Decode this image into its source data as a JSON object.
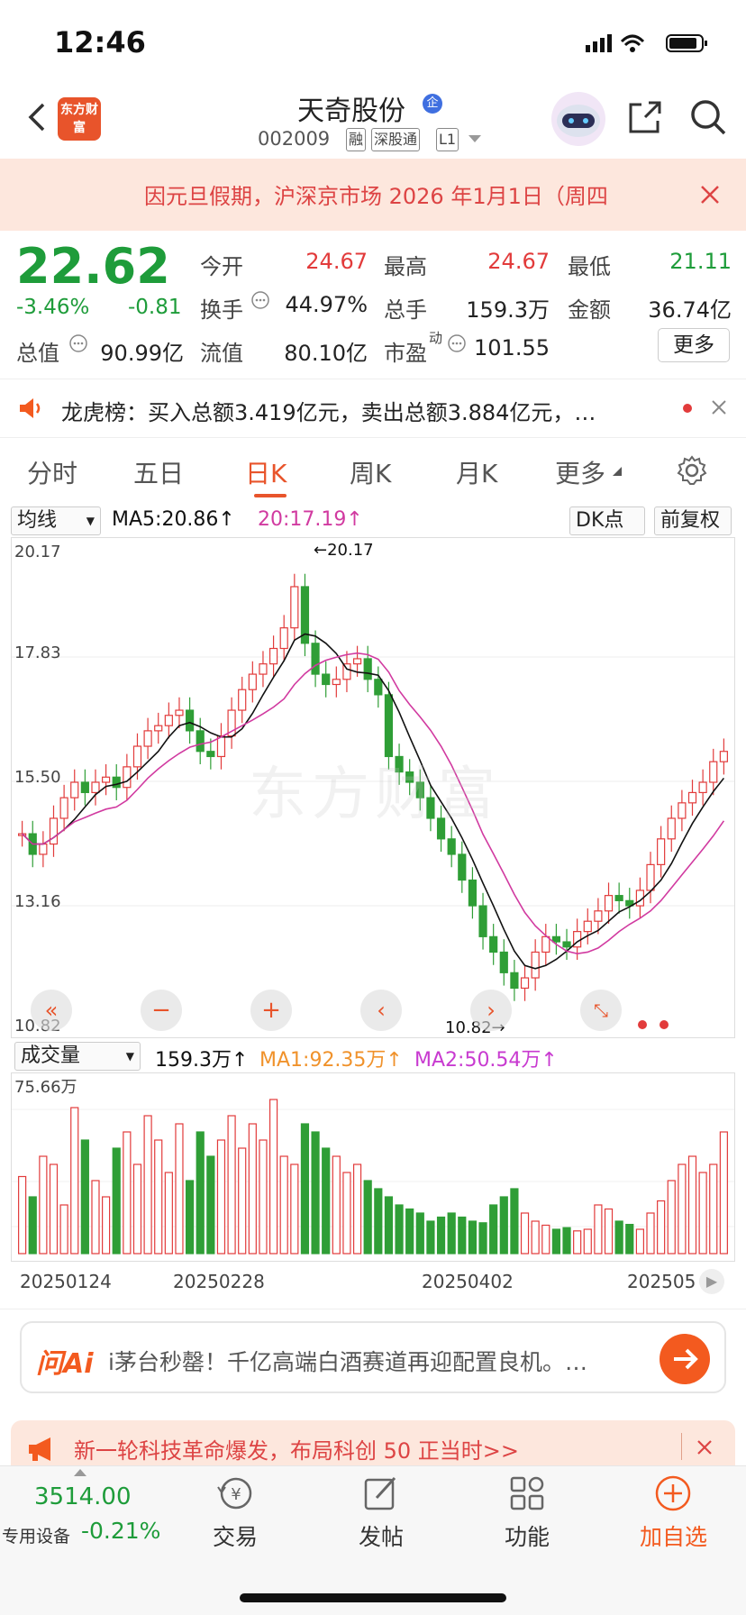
{
  "status": {
    "time": "12:46"
  },
  "header": {
    "logo_text": "东方财富",
    "stock_name": "天奇股份",
    "badge": "企",
    "code": "002009",
    "tags": [
      "融",
      "深股通",
      "L1"
    ]
  },
  "notice": {
    "text": "因元旦假期，沪深京市场 2026 年1月1日（周四"
  },
  "quote": {
    "price": "22.62",
    "pct": "-3.46%",
    "chg": "-0.81",
    "fields": [
      {
        "label": "今开",
        "value": "24.67",
        "color": "red"
      },
      {
        "label": "最高",
        "value": "24.67",
        "color": "red"
      },
      {
        "label": "最低",
        "value": "21.11",
        "color": "green"
      },
      {
        "label": "换手",
        "value": "44.97%",
        "color": "dark"
      },
      {
        "label": "总手",
        "value": "159.3万",
        "color": "dark"
      },
      {
        "label": "金额",
        "value": "36.74亿",
        "color": "dark"
      },
      {
        "label": "总值",
        "value": "90.99亿",
        "color": "dark"
      },
      {
        "label": "流值",
        "value": "80.10亿",
        "color": "dark"
      },
      {
        "label": "市盈",
        "sup": "动",
        "value": "101.55",
        "color": "dark"
      }
    ],
    "more": "更多"
  },
  "lhb": {
    "text": "龙虎榜：买入总额3.419亿元，卖出总额3.884亿元，…"
  },
  "tabs": [
    "分时",
    "五日",
    "日K",
    "周K",
    "月K",
    "更多"
  ],
  "active_tab": "日K",
  "kchart": {
    "indicator": "均线",
    "ma5": "MA5:20.86↑",
    "ma10": "20:17.19↑",
    "dk": "DK点",
    "adjust": "前复权",
    "y_labels": [
      "20.17",
      "17.83",
      "15.50",
      "13.16",
      "10.82"
    ],
    "high_label": "←20.17",
    "low_label": "10.82→",
    "watermark": "东方财富"
  },
  "volume": {
    "indicator": "成交量",
    "value": "159.3万↑",
    "ma1": "MA1:92.35万↑",
    "ma2": "MA2:50.54万↑",
    "max_label": "75.66万",
    "dates": [
      "20250124",
      "20250228",
      "20250402",
      "202505"
    ]
  },
  "ai": {
    "logo": "问Ai",
    "text": "i茅台秒罄！千亿高端白酒赛道再迎配置良机。…"
  },
  "ad": {
    "text": "新一轮科技革命爆发，布局科创 50 正当时>>"
  },
  "bottom": {
    "index_value": "3514.00",
    "index_label": "专用设备",
    "index_pct": "-0.21%",
    "items": [
      "交易",
      "发帖",
      "功能",
      "加自选"
    ]
  },
  "chart_data": {
    "type": "candlestick",
    "ylim": [
      10.82,
      20.17
    ],
    "y_ticks": [
      20.17,
      17.83,
      15.5,
      13.16,
      10.82
    ],
    "x_ticks": [
      "20250124",
      "20250228",
      "20250402",
      "202505"
    ],
    "series": [
      {
        "name": "MA5",
        "last": 20.86
      },
      {
        "name": "20",
        "last": 17.19
      }
    ],
    "high": 20.17,
    "low": 10.82,
    "volume": {
      "max": "75.66万",
      "last": "159.3万",
      "MA1": "92.35万",
      "MA2": "50.54万"
    }
  }
}
